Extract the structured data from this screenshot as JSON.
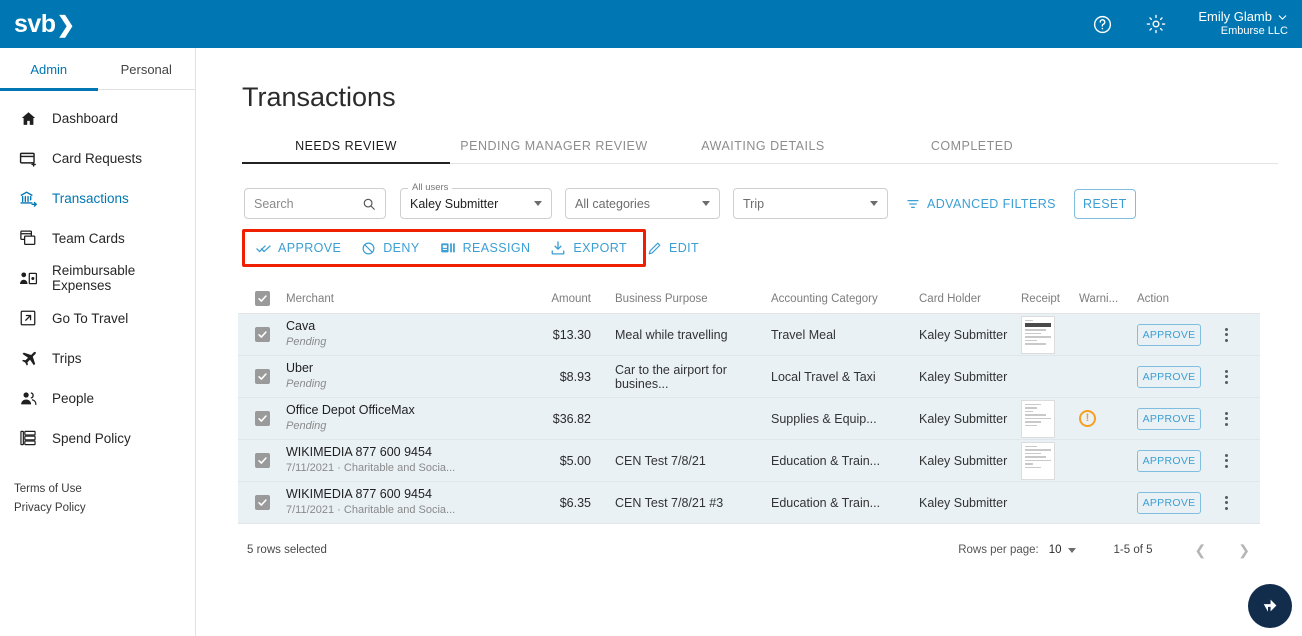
{
  "topbar": {
    "logo_text": "svb",
    "logo_chevron": "❯",
    "help_icon": "help-circle-icon",
    "settings_icon": "gear-icon",
    "user_name": "Emily Glamb",
    "user_org": "Emburse LLC"
  },
  "sidebar": {
    "tabs": [
      {
        "label": "Admin",
        "active": true
      },
      {
        "label": "Personal",
        "active": false
      }
    ],
    "items": [
      {
        "label": "Dashboard",
        "icon": "home-icon",
        "active": false
      },
      {
        "label": "Card Requests",
        "icon": "credit-card-plus-icon",
        "active": false
      },
      {
        "label": "Transactions",
        "icon": "bank-transfer-icon",
        "active": true
      },
      {
        "label": "Team Cards",
        "icon": "cards-stack-icon",
        "active": false
      },
      {
        "label": "Reimbursable Expenses",
        "icon": "person-card-icon",
        "active": false
      },
      {
        "label": "Go To Travel",
        "icon": "external-link-icon",
        "active": false
      },
      {
        "label": "Trips",
        "icon": "airplane-icon",
        "active": false
      },
      {
        "label": "People",
        "icon": "people-icon",
        "active": false
      },
      {
        "label": "Spend Policy",
        "icon": "policy-list-icon",
        "active": false
      }
    ],
    "legal": [
      {
        "label": "Terms of Use"
      },
      {
        "label": "Privacy Policy"
      }
    ]
  },
  "main": {
    "page_title": "Transactions",
    "tabs": [
      {
        "label": "NEEDS REVIEW",
        "active": true
      },
      {
        "label": "PENDING MANAGER REVIEW",
        "active": false
      },
      {
        "label": "AWAITING DETAILS",
        "active": false
      },
      {
        "label": "COMPLETED",
        "active": false
      }
    ],
    "filters": {
      "search_placeholder": "Search",
      "search_value": "",
      "search_icon": "search-icon",
      "user_label": "All users",
      "user_value": "Kaley Submitter",
      "category_value": "All categories",
      "trip_value": "Trip",
      "advanced_filters_label": "ADVANCED FILTERS",
      "advanced_filters_icon": "filter-icon",
      "reset_label": "RESET"
    },
    "action_bar": {
      "highlight_color": "#ef2000",
      "actions": [
        {
          "label": "APPROVE",
          "icon": "double-check-icon"
        },
        {
          "label": "DENY",
          "icon": "circle-slash-icon"
        },
        {
          "label": "REASSIGN",
          "icon": "reassign-card-icon"
        },
        {
          "label": "EXPORT",
          "icon": "download-icon"
        },
        {
          "label": "EDIT",
          "icon": "pencil-icon"
        }
      ]
    },
    "table": {
      "columns": [
        "Merchant",
        "Amount",
        "Business Purpose",
        "Accounting Category",
        "Card Holder",
        "Receipt",
        "Warni...",
        "Action"
      ],
      "header_checkbox_checked": true,
      "rows": [
        {
          "checked": true,
          "merchant": "Cava",
          "sub": "Pending",
          "sub_italic": true,
          "amount": "$13.30",
          "purpose": "Meal while travelling",
          "category": "Travel Meal",
          "holder": "Kaley Submitter",
          "has_receipt": true,
          "has_warning": false,
          "action_label": "APPROVE"
        },
        {
          "checked": true,
          "merchant": "Uber",
          "sub": "Pending",
          "sub_italic": true,
          "amount": "$8.93",
          "purpose": "Car to the airport for busines...",
          "category": "Local Travel & Taxi",
          "holder": "Kaley Submitter",
          "has_receipt": false,
          "has_warning": false,
          "action_label": "APPROVE"
        },
        {
          "checked": true,
          "merchant": "Office Depot OfficeMax",
          "sub": "Pending",
          "sub_italic": true,
          "amount": "$36.82",
          "purpose": "",
          "category": "Supplies & Equip...",
          "holder": "Kaley Submitter",
          "has_receipt": true,
          "has_warning": true,
          "action_label": "APPROVE"
        },
        {
          "checked": true,
          "merchant": "WIKIMEDIA 877 600 9454",
          "sub": "7/11/2021 · Charitable and Socia...",
          "sub_italic": false,
          "amount": "$5.00",
          "purpose": "CEN Test 7/8/21",
          "category": "Education & Train...",
          "holder": "Kaley Submitter",
          "has_receipt": true,
          "has_warning": false,
          "action_label": "APPROVE"
        },
        {
          "checked": true,
          "merchant": "WIKIMEDIA 877 600 9454",
          "sub": "7/11/2021 · Charitable and Socia...",
          "sub_italic": false,
          "amount": "$6.35",
          "purpose": "CEN Test 7/8/21 #3",
          "category": "Education & Train...",
          "holder": "Kaley Submitter",
          "has_receipt": false,
          "has_warning": false,
          "action_label": "APPROVE"
        }
      ]
    },
    "footer": {
      "rows_selected": "5 rows selected",
      "rows_per_page_label": "Rows per page:",
      "rows_per_page_value": "10",
      "range": "1-5 of 5",
      "prev_icon": "chevron-left-icon",
      "next_icon": "chevron-right-icon"
    },
    "fab": {
      "icon": "support-chat-icon",
      "color": "#122c4b"
    }
  },
  "colors": {
    "brand_blue": "#0077b3",
    "link_blue": "#3b9fd4",
    "row_selected_bg": "#e9f1f5",
    "warning_orange": "#f5a020",
    "highlight_red": "#ef2000"
  }
}
